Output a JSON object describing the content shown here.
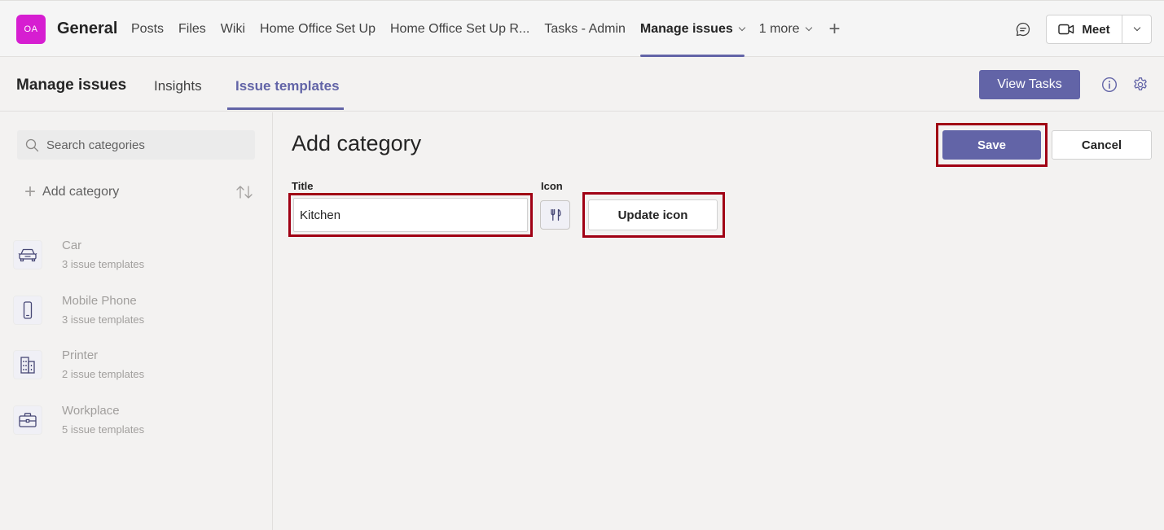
{
  "header": {
    "team_initials": "OA",
    "channel_name": "General",
    "tabs": [
      {
        "label": "Posts"
      },
      {
        "label": "Files"
      },
      {
        "label": "Wiki"
      },
      {
        "label": "Home Office Set Up"
      },
      {
        "label": "Home Office Set Up R..."
      },
      {
        "label": "Tasks - Admin"
      },
      {
        "label": "Manage issues"
      },
      {
        "label": "1 more"
      }
    ],
    "meet_label": "Meet"
  },
  "subnav": {
    "app_title": "Manage issues",
    "tabs": [
      {
        "label": "Insights"
      },
      {
        "label": "Issue templates"
      }
    ],
    "view_tasks_label": "View Tasks"
  },
  "sidebar": {
    "search_placeholder": "Search categories",
    "add_category_label": "Add category",
    "categories": [
      {
        "name": "Car",
        "count": "3 issue templates",
        "icon": "car-icon"
      },
      {
        "name": "Mobile Phone",
        "count": "3 issue templates",
        "icon": "phone-icon"
      },
      {
        "name": "Printer",
        "count": "2 issue templates",
        "icon": "building-icon"
      },
      {
        "name": "Workplace",
        "count": "5 issue templates",
        "icon": "briefcase-icon"
      }
    ]
  },
  "form": {
    "heading": "Add category",
    "save_label": "Save",
    "cancel_label": "Cancel",
    "title_label": "Title",
    "title_value": "Kitchen",
    "icon_label": "Icon",
    "icon_name": "utensils-icon",
    "update_icon_label": "Update icon"
  },
  "colors": {
    "accent": "#6264a7",
    "highlight_outline": "#a00014",
    "avatar": "#d61ed1"
  }
}
